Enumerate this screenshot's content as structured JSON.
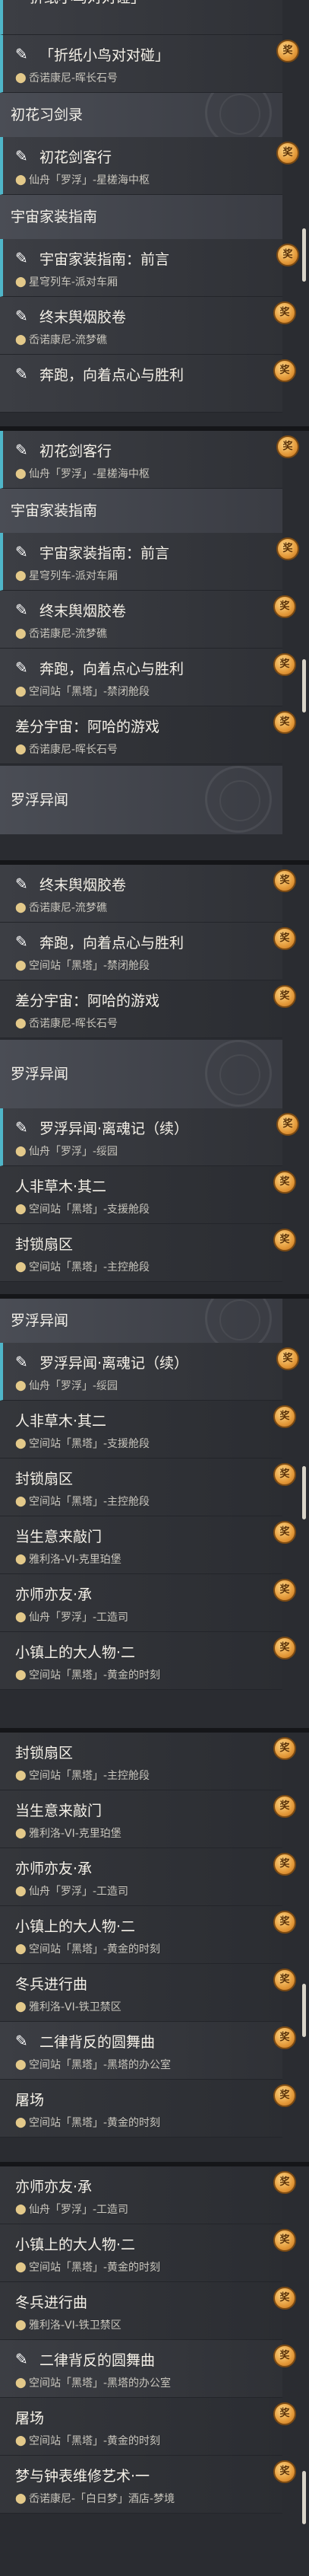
{
  "sections": {
    "hatsuka": "初花习剑录",
    "uchuu": "宇宙家装指南",
    "luofu": "罗浮异闻"
  },
  "quests": {
    "paper_bird": {
      "title": "「折纸小鸟对对碰」",
      "location": "岙诺康尼-晖长石号"
    },
    "hatsuka_guest": {
      "title": "初花剑客行",
      "location": "仙舟「罗浮」-星槎海中枢"
    },
    "uchuu_prelude": {
      "title": "宇宙家装指南：前言",
      "location": "星穹列车-派对车厢"
    },
    "final_film": {
      "title": "终末舆烟胶卷",
      "location": "岙诺康尼-流梦礁"
    },
    "run_heart": {
      "title": "奔跑，向着点心与胜利",
      "location": "空间站「黑塔」-禁闭舱段"
    },
    "diff_universe": {
      "title": "差分宇宙：阿哈的游戏",
      "location": "岙诺康尼-晖长石号"
    },
    "luofu_soul": {
      "title": "罗浮异闻·离魂记（续）",
      "location": "仙舟「罗浮」-绥园"
    },
    "people_grass": {
      "title": "人非草木·其二",
      "location": "空间站「黑塔」-支援舱段"
    },
    "sealed_fan": {
      "title": "封锁扇区",
      "location": "空间站「黑塔」-主控舱段"
    },
    "autumn_gate": {
      "title": "当生意来敲门",
      "location": "雅利洛-VI-克里珀堡"
    },
    "teacher_friend": {
      "title": "亦师亦友·承",
      "location": "仙舟「罗浮」-工造司"
    },
    "small_town": {
      "title": "小镇上的大人物·二",
      "location": "空间站「黑塔」-黄金的时刻"
    },
    "winter_march": {
      "title": "冬兵进行曲",
      "location": "雅利洛-VI-铁卫禁区"
    },
    "binary_dance": {
      "title": "二律背反的圆舞曲",
      "location": "空间站「黑塔」-黑塔的办公室"
    },
    "arena": {
      "title": "屠场",
      "location": "空间站「黑塔」-黄金的时刻"
    },
    "dream_clock": {
      "title": "梦与钟表维修艺术·一",
      "location": "岙诺康尼-「白日梦」酒店-梦境"
    }
  },
  "ui": {
    "reward_badge": "奖",
    "colors": {
      "accent": "#4fb6c9",
      "badge": "#e49a3a",
      "pin": "#e3c98a"
    },
    "icons": {
      "quest": "feather-icon",
      "location": "pin-icon",
      "reward": "reward-badge-icon"
    }
  }
}
